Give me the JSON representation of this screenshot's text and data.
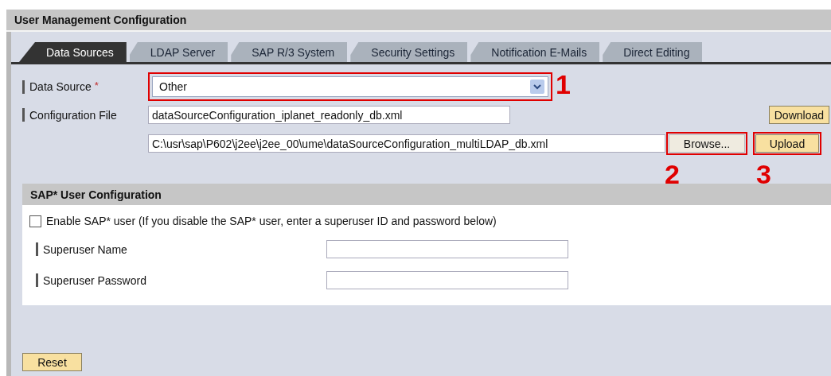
{
  "title": "User Management Configuration",
  "tabs": [
    {
      "label": "Data Sources",
      "selected": true
    },
    {
      "label": "LDAP Server",
      "selected": false
    },
    {
      "label": "SAP R/3 System",
      "selected": false
    },
    {
      "label": "Security Settings",
      "selected": false
    },
    {
      "label": "Notification E-Mails",
      "selected": false
    },
    {
      "label": "Direct Editing",
      "selected": false
    }
  ],
  "data_source": {
    "label": "Data Source",
    "required_mark": "*",
    "value": "Other",
    "callout": "1"
  },
  "configuration_file": {
    "label": "Configuration File",
    "value": "dataSourceConfiguration_iplanet_readonly_db.xml",
    "download_button": "Download",
    "upload_path": "C:\\usr\\sap\\P602\\j2ee\\j2ee_00\\ume\\dataSourceConfiguration_multiLDAP_db.xml",
    "browse_button": "Browse...",
    "browse_callout": "2",
    "upload_button": "Upload",
    "upload_callout": "3"
  },
  "sap_user": {
    "title": "SAP* User Configuration",
    "enable": {
      "label": "Enable SAP* user (If you disable the SAP* user, enter a superuser ID and password below)",
      "checked": false
    },
    "fields": [
      {
        "label": "Superuser Name"
      },
      {
        "label": "Superuser Password"
      }
    ]
  },
  "reset_button": "Reset"
}
